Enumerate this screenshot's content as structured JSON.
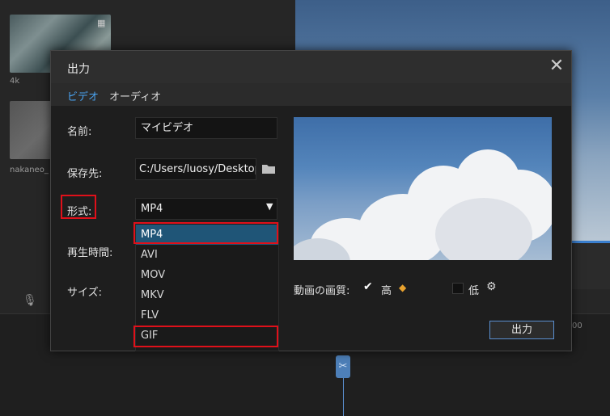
{
  "background": {
    "clips": [
      {
        "label": "4k"
      },
      {
        "label": "nakaneo_"
      }
    ],
    "ruler_tail": "00"
  },
  "dialog": {
    "title": "出力",
    "tabs": [
      {
        "label": "ビデオ",
        "active": true
      },
      {
        "label": "オーディオ",
        "active": false
      }
    ],
    "fields": {
      "name_label": "名前:",
      "name_value": "マイビデオ",
      "save_label": "保存先:",
      "save_value": "C:/Users/luosy/Desktop",
      "format_label": "形式:",
      "format_value": "MP4",
      "duration_label": "再生時間:",
      "size_label": "サイズ:"
    },
    "format_options": [
      "MP4",
      "AVI",
      "MOV",
      "MKV",
      "FLV",
      "GIF"
    ],
    "quality": {
      "label": "動画の画質:",
      "high_label": "高",
      "high_checked": true,
      "low_label": "低",
      "low_checked": false
    },
    "export_button": "出力",
    "colors": {
      "accent": "#4aa3f0",
      "highlight": "#e0101a",
      "selected_option": "#1f5577"
    }
  }
}
